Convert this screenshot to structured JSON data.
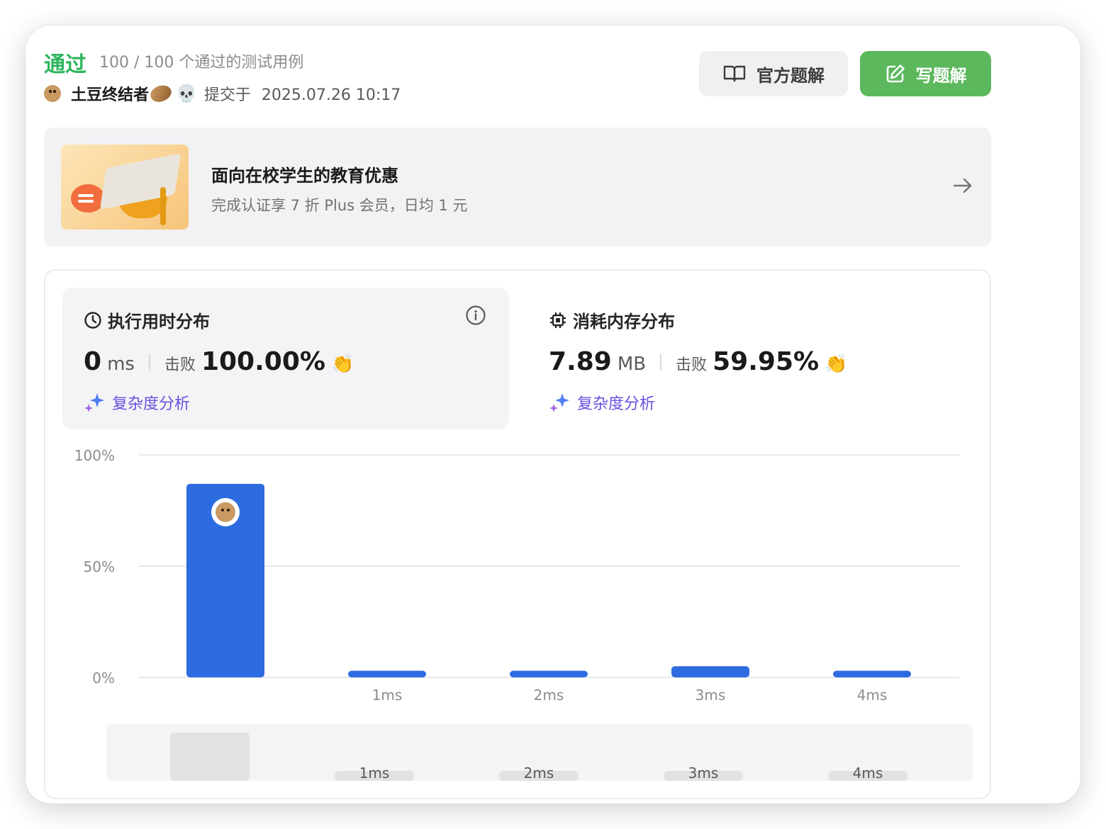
{
  "header": {
    "status": "通过",
    "testcases": "100 / 100 个通过的测试用例",
    "username": "土豆终结者",
    "skull": "💀",
    "submitted_label": "提交于",
    "submitted_time": "2025.07.26 10:17"
  },
  "buttons": {
    "official": "官方题解",
    "write": "写题解"
  },
  "promo": {
    "title": "面向在校学生的教育优惠",
    "subtitle": "完成认证享 7 折 Plus 会员，日均 1 元"
  },
  "runtime": {
    "title": "执行用时分布",
    "value": "0",
    "unit": "ms",
    "beat_label": "击败",
    "beat_pct": "100.00%",
    "complexity": "复杂度分析"
  },
  "memory": {
    "title": "消耗内存分布",
    "value": "7.89",
    "unit": "MB",
    "beat_label": "击败",
    "beat_pct": "59.95%",
    "complexity": "复杂度分析"
  },
  "colors": {
    "accent_green": "#2db55d",
    "button_green": "#5cb85c",
    "bar_blue": "#2d6be0",
    "purple": "#6b4fe0"
  },
  "chart_data": {
    "type": "bar",
    "categories": [
      "0ms",
      "1ms",
      "2ms",
      "3ms",
      "4ms"
    ],
    "tick_labels": [
      "",
      "1ms",
      "2ms",
      "3ms",
      "4ms"
    ],
    "values": [
      87,
      3,
      3,
      5,
      3
    ],
    "y_ticks": [
      "0%",
      "50%",
      "100%"
    ],
    "ylim": [
      0,
      100
    ],
    "grid": true,
    "highlight_index": 0
  },
  "mini_chart": {
    "labels": [
      "1ms",
      "2ms",
      "3ms",
      "4ms"
    ]
  }
}
